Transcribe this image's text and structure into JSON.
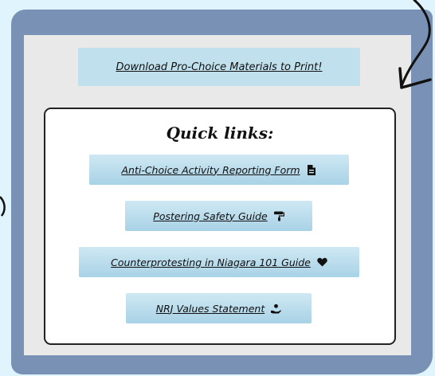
{
  "download": {
    "label": "Download Pro-Choice Materials to Print!"
  },
  "quick_links": {
    "title": "Quick links:",
    "items": [
      {
        "label": "Anti-Choice Activity Reporting Form",
        "icon": "file-icon"
      },
      {
        "label": "Postering Safety Guide",
        "icon": "paint-roller-icon"
      },
      {
        "label": "Counterprotesting in Niagara 101 Guide",
        "icon": "heart-icon"
      },
      {
        "label": "NRJ Values Statement",
        "icon": "hand-holding-icon"
      }
    ]
  },
  "colors": {
    "background": "#dff4fd",
    "frame": "#7991b4",
    "panel": "#e9e9e9",
    "button": "#bfe0ec"
  }
}
